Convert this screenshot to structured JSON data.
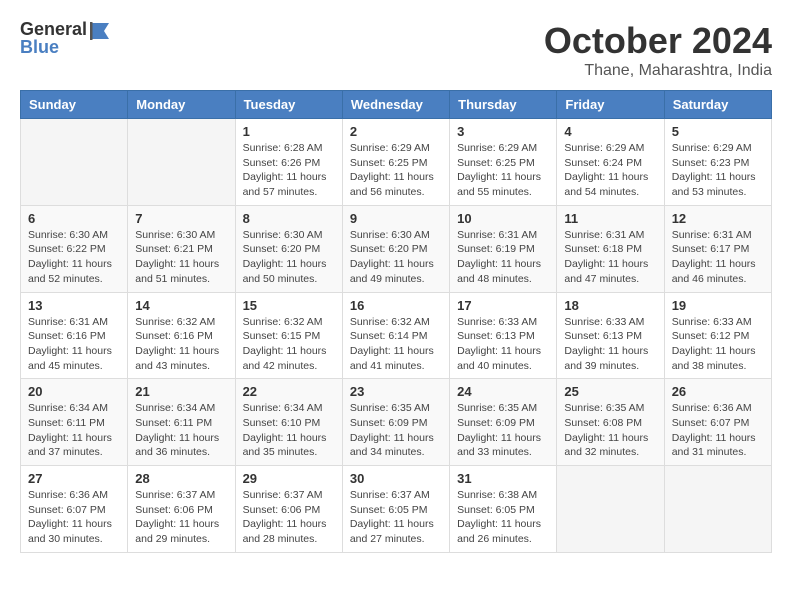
{
  "header": {
    "logo_general": "General",
    "logo_blue": "Blue",
    "month": "October 2024",
    "location": "Thane, Maharashtra, India"
  },
  "days_of_week": [
    "Sunday",
    "Monday",
    "Tuesday",
    "Wednesday",
    "Thursday",
    "Friday",
    "Saturday"
  ],
  "weeks": [
    [
      {
        "day": "",
        "info": ""
      },
      {
        "day": "",
        "info": ""
      },
      {
        "day": "1",
        "info": "Sunrise: 6:28 AM\nSunset: 6:26 PM\nDaylight: 11 hours and 57 minutes."
      },
      {
        "day": "2",
        "info": "Sunrise: 6:29 AM\nSunset: 6:25 PM\nDaylight: 11 hours and 56 minutes."
      },
      {
        "day": "3",
        "info": "Sunrise: 6:29 AM\nSunset: 6:25 PM\nDaylight: 11 hours and 55 minutes."
      },
      {
        "day": "4",
        "info": "Sunrise: 6:29 AM\nSunset: 6:24 PM\nDaylight: 11 hours and 54 minutes."
      },
      {
        "day": "5",
        "info": "Sunrise: 6:29 AM\nSunset: 6:23 PM\nDaylight: 11 hours and 53 minutes."
      }
    ],
    [
      {
        "day": "6",
        "info": "Sunrise: 6:30 AM\nSunset: 6:22 PM\nDaylight: 11 hours and 52 minutes."
      },
      {
        "day": "7",
        "info": "Sunrise: 6:30 AM\nSunset: 6:21 PM\nDaylight: 11 hours and 51 minutes."
      },
      {
        "day": "8",
        "info": "Sunrise: 6:30 AM\nSunset: 6:20 PM\nDaylight: 11 hours and 50 minutes."
      },
      {
        "day": "9",
        "info": "Sunrise: 6:30 AM\nSunset: 6:20 PM\nDaylight: 11 hours and 49 minutes."
      },
      {
        "day": "10",
        "info": "Sunrise: 6:31 AM\nSunset: 6:19 PM\nDaylight: 11 hours and 48 minutes."
      },
      {
        "day": "11",
        "info": "Sunrise: 6:31 AM\nSunset: 6:18 PM\nDaylight: 11 hours and 47 minutes."
      },
      {
        "day": "12",
        "info": "Sunrise: 6:31 AM\nSunset: 6:17 PM\nDaylight: 11 hours and 46 minutes."
      }
    ],
    [
      {
        "day": "13",
        "info": "Sunrise: 6:31 AM\nSunset: 6:16 PM\nDaylight: 11 hours and 45 minutes."
      },
      {
        "day": "14",
        "info": "Sunrise: 6:32 AM\nSunset: 6:16 PM\nDaylight: 11 hours and 43 minutes."
      },
      {
        "day": "15",
        "info": "Sunrise: 6:32 AM\nSunset: 6:15 PM\nDaylight: 11 hours and 42 minutes."
      },
      {
        "day": "16",
        "info": "Sunrise: 6:32 AM\nSunset: 6:14 PM\nDaylight: 11 hours and 41 minutes."
      },
      {
        "day": "17",
        "info": "Sunrise: 6:33 AM\nSunset: 6:13 PM\nDaylight: 11 hours and 40 minutes."
      },
      {
        "day": "18",
        "info": "Sunrise: 6:33 AM\nSunset: 6:13 PM\nDaylight: 11 hours and 39 minutes."
      },
      {
        "day": "19",
        "info": "Sunrise: 6:33 AM\nSunset: 6:12 PM\nDaylight: 11 hours and 38 minutes."
      }
    ],
    [
      {
        "day": "20",
        "info": "Sunrise: 6:34 AM\nSunset: 6:11 PM\nDaylight: 11 hours and 37 minutes."
      },
      {
        "day": "21",
        "info": "Sunrise: 6:34 AM\nSunset: 6:11 PM\nDaylight: 11 hours and 36 minutes."
      },
      {
        "day": "22",
        "info": "Sunrise: 6:34 AM\nSunset: 6:10 PM\nDaylight: 11 hours and 35 minutes."
      },
      {
        "day": "23",
        "info": "Sunrise: 6:35 AM\nSunset: 6:09 PM\nDaylight: 11 hours and 34 minutes."
      },
      {
        "day": "24",
        "info": "Sunrise: 6:35 AM\nSunset: 6:09 PM\nDaylight: 11 hours and 33 minutes."
      },
      {
        "day": "25",
        "info": "Sunrise: 6:35 AM\nSunset: 6:08 PM\nDaylight: 11 hours and 32 minutes."
      },
      {
        "day": "26",
        "info": "Sunrise: 6:36 AM\nSunset: 6:07 PM\nDaylight: 11 hours and 31 minutes."
      }
    ],
    [
      {
        "day": "27",
        "info": "Sunrise: 6:36 AM\nSunset: 6:07 PM\nDaylight: 11 hours and 30 minutes."
      },
      {
        "day": "28",
        "info": "Sunrise: 6:37 AM\nSunset: 6:06 PM\nDaylight: 11 hours and 29 minutes."
      },
      {
        "day": "29",
        "info": "Sunrise: 6:37 AM\nSunset: 6:06 PM\nDaylight: 11 hours and 28 minutes."
      },
      {
        "day": "30",
        "info": "Sunrise: 6:37 AM\nSunset: 6:05 PM\nDaylight: 11 hours and 27 minutes."
      },
      {
        "day": "31",
        "info": "Sunrise: 6:38 AM\nSunset: 6:05 PM\nDaylight: 11 hours and 26 minutes."
      },
      {
        "day": "",
        "info": ""
      },
      {
        "day": "",
        "info": ""
      }
    ]
  ]
}
